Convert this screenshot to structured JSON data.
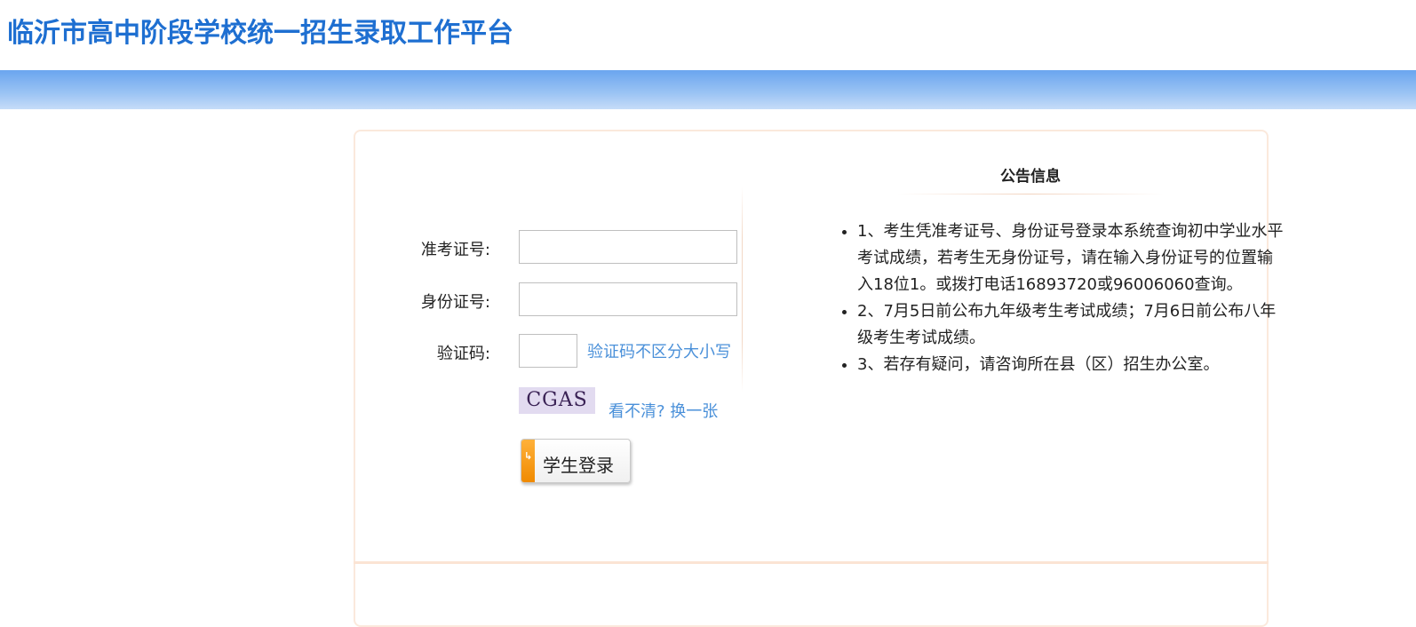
{
  "header": {
    "title": "临沂市高中阶段学校统一招生录取工作平台"
  },
  "login_form": {
    "exam_id_label": "准考证号:",
    "exam_id_value": "",
    "id_card_label": "身份证号:",
    "id_card_value": "",
    "captcha_label": "验证码:",
    "captcha_value": "",
    "captcha_hint": "验证码不区分大小写",
    "captcha_image_text": "CGAS",
    "refresh_link": "看不清? 换一张",
    "login_button": "学生登录"
  },
  "notice": {
    "title": "公告信息",
    "items": [
      "1、考生凭准考证号、身份证号登录本系统查询初中学业水平考试成绩，若考生无身份证号，请在输入身份证号的位置输入18位1。或拨打电话16893720或96006060查询。",
      "2、7月5日前公布九年级考生考试成绩；7月6日前公布八年级考生考试成绩。",
      "3、若存有疑问，请咨询所在县（区）招生办公室。"
    ]
  },
  "colors": {
    "title_blue": "#1e6fd1",
    "link_blue": "#4a90d9",
    "button_accent": "#f08a00"
  }
}
